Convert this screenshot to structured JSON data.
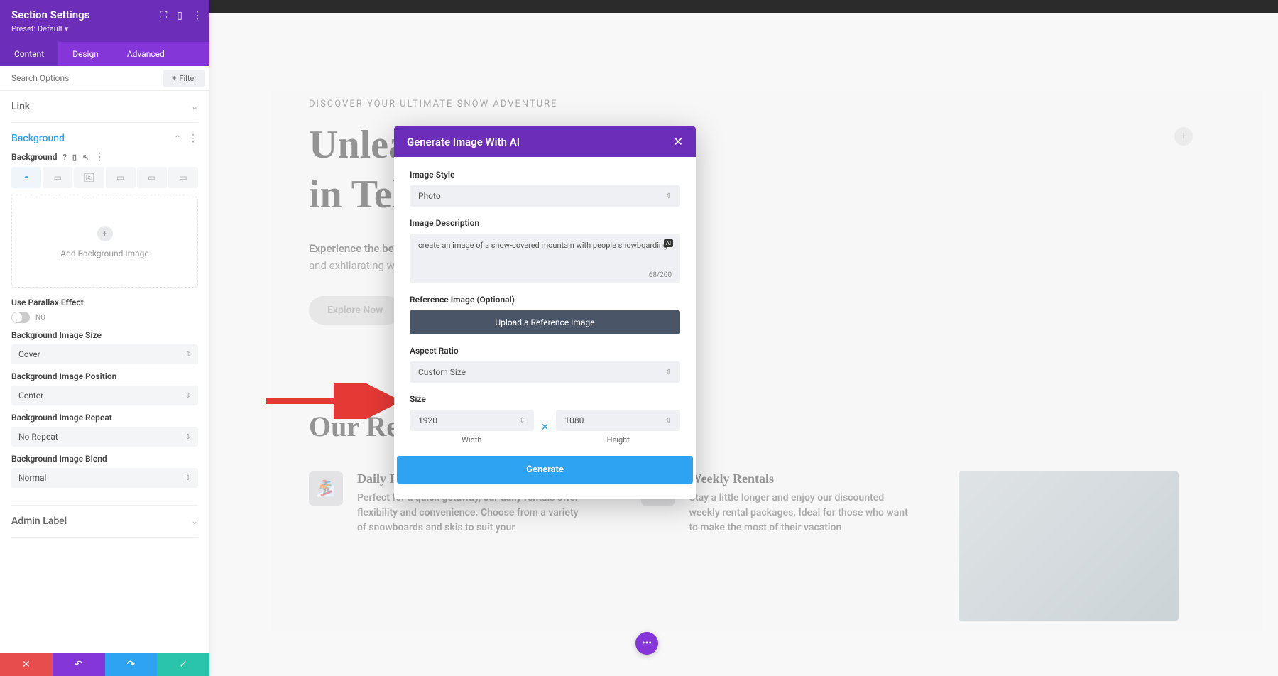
{
  "sidebar": {
    "title": "Section Settings",
    "preset": "Preset: Default",
    "tabs": {
      "content": "Content",
      "design": "Design",
      "advanced": "Advanced"
    },
    "search_placeholder": "Search Options",
    "filter": "Filter",
    "link_section": "Link",
    "background_section": "Background",
    "background_label": "Background",
    "add_bg_text": "Add Background Image",
    "parallax_label": "Use Parallax Effect",
    "parallax_value": "NO",
    "bg_size_label": "Background Image Size",
    "bg_size_value": "Cover",
    "bg_pos_label": "Background Image Position",
    "bg_pos_value": "Center",
    "bg_repeat_label": "Background Image Repeat",
    "bg_repeat_value": "No Repeat",
    "bg_blend_label": "Background Image Blend",
    "bg_blend_value": "Normal",
    "admin_label": "Admin Label"
  },
  "hero": {
    "eyebrow": "DISCOVER YOUR ULTIMATE SNOW ADVENTURE",
    "h1a": "Unlea",
    "h1b": "in Tel",
    "sub1": "Experience the best",
    "sub2": "and exhilarating w",
    "cta": "Explore Now"
  },
  "section2": {
    "heading": "Our Re",
    "daily": {
      "title": "Daily Rentals",
      "desc": "Perfect for a quick getaway, our daily rentals offer flexibility and convenience. Choose from a variety of snowboards and skis to suit your"
    },
    "weekly": {
      "title": "Weekly Rentals",
      "desc": "Stay a little longer and enjoy our discounted weekly rental packages. Ideal for those who want to make the most of their vacation"
    }
  },
  "modal": {
    "title": "Generate Image With AI",
    "style_label": "Image Style",
    "style_value": "Photo",
    "desc_label": "Image Description",
    "desc_value": "create an image of a snow-covered mountain with people snowboarding",
    "desc_count": "68/200",
    "ref_label": "Reference Image (Optional)",
    "upload_btn": "Upload a Reference Image",
    "aspect_label": "Aspect Ratio",
    "aspect_value": "Custom Size",
    "size_label": "Size",
    "width_value": "1920",
    "height_value": "1080",
    "width_label": "Width",
    "height_label": "Height",
    "generate": "Generate"
  }
}
